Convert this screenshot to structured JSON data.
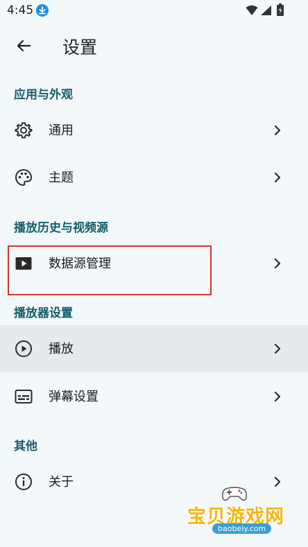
{
  "status_bar": {
    "time": "4:45"
  },
  "app_bar": {
    "title": "设置",
    "back_icon": "arrow-left-icon"
  },
  "sections": [
    {
      "header": "应用与外观"
    },
    {
      "header": "播放历史与视频源"
    },
    {
      "header": "播放器设置"
    },
    {
      "header": "其他"
    }
  ],
  "rows": {
    "general": {
      "label": "通用",
      "icon": "gear-icon"
    },
    "theme": {
      "label": "主题",
      "icon": "palette-icon"
    },
    "data_source": {
      "label": "数据源管理",
      "icon": "play-box-icon"
    },
    "playback": {
      "label": "播放",
      "icon": "play-circle-icon"
    },
    "danmaku": {
      "label": "弹幕设置",
      "icon": "subtitles-icon"
    },
    "about": {
      "label": "关于",
      "icon": "info-icon"
    }
  },
  "watermark": {
    "text": "宝贝游戏网",
    "url": "baobeiy.com"
  },
  "colors": {
    "background": "#f3f8fb",
    "section_header": "#145d6b",
    "highlight_row": "#e6eaec",
    "annotation_box": "#d63333"
  }
}
